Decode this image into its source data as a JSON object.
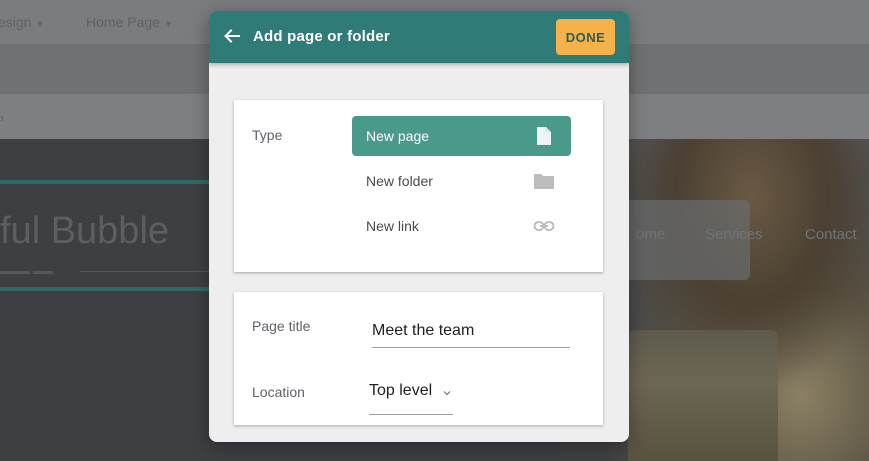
{
  "background": {
    "breadcrumbs": [
      "esign",
      "Home Page"
    ],
    "site_title": "ful Bubble",
    "nav_items": [
      "ome",
      "Services",
      "Contact"
    ]
  },
  "dialog": {
    "title": "Add page or folder",
    "done_label": "DONE",
    "type_section": {
      "label": "Type",
      "options": [
        {
          "label": "New page",
          "icon": "page-icon",
          "selected": true
        },
        {
          "label": "New folder",
          "icon": "folder-icon",
          "selected": false
        },
        {
          "label": "New link",
          "icon": "link-icon",
          "selected": false
        }
      ]
    },
    "fields": {
      "page_title_label": "Page title",
      "page_title_value": "Meet the team",
      "location_label": "Location",
      "location_value": "Top level"
    }
  },
  "colors": {
    "header": "#2f7b77",
    "accent": "#4a9a8c",
    "done": "#f5b24a"
  }
}
